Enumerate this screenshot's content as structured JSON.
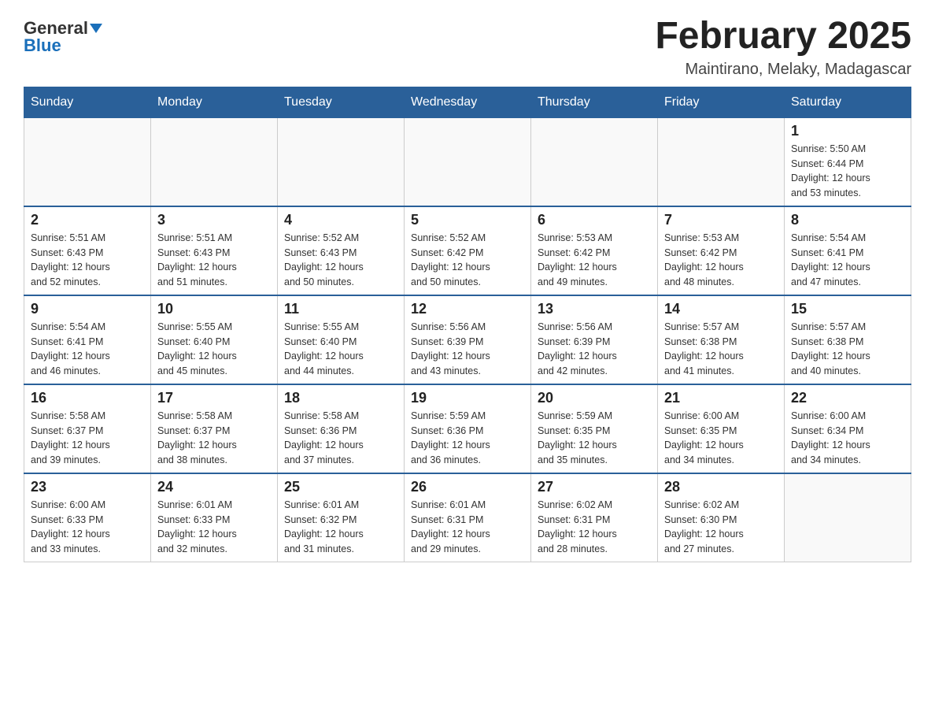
{
  "logo": {
    "general": "General",
    "blue": "Blue"
  },
  "title": "February 2025",
  "location": "Maintirano, Melaky, Madagascar",
  "days_of_week": [
    "Sunday",
    "Monday",
    "Tuesday",
    "Wednesday",
    "Thursday",
    "Friday",
    "Saturday"
  ],
  "weeks": [
    [
      {
        "day": "",
        "info": []
      },
      {
        "day": "",
        "info": []
      },
      {
        "day": "",
        "info": []
      },
      {
        "day": "",
        "info": []
      },
      {
        "day": "",
        "info": []
      },
      {
        "day": "",
        "info": []
      },
      {
        "day": "1",
        "info": [
          "Sunrise: 5:50 AM",
          "Sunset: 6:44 PM",
          "Daylight: 12 hours",
          "and 53 minutes."
        ]
      }
    ],
    [
      {
        "day": "2",
        "info": [
          "Sunrise: 5:51 AM",
          "Sunset: 6:43 PM",
          "Daylight: 12 hours",
          "and 52 minutes."
        ]
      },
      {
        "day": "3",
        "info": [
          "Sunrise: 5:51 AM",
          "Sunset: 6:43 PM",
          "Daylight: 12 hours",
          "and 51 minutes."
        ]
      },
      {
        "day": "4",
        "info": [
          "Sunrise: 5:52 AM",
          "Sunset: 6:43 PM",
          "Daylight: 12 hours",
          "and 50 minutes."
        ]
      },
      {
        "day": "5",
        "info": [
          "Sunrise: 5:52 AM",
          "Sunset: 6:42 PM",
          "Daylight: 12 hours",
          "and 50 minutes."
        ]
      },
      {
        "day": "6",
        "info": [
          "Sunrise: 5:53 AM",
          "Sunset: 6:42 PM",
          "Daylight: 12 hours",
          "and 49 minutes."
        ]
      },
      {
        "day": "7",
        "info": [
          "Sunrise: 5:53 AM",
          "Sunset: 6:42 PM",
          "Daylight: 12 hours",
          "and 48 minutes."
        ]
      },
      {
        "day": "8",
        "info": [
          "Sunrise: 5:54 AM",
          "Sunset: 6:41 PM",
          "Daylight: 12 hours",
          "and 47 minutes."
        ]
      }
    ],
    [
      {
        "day": "9",
        "info": [
          "Sunrise: 5:54 AM",
          "Sunset: 6:41 PM",
          "Daylight: 12 hours",
          "and 46 minutes."
        ]
      },
      {
        "day": "10",
        "info": [
          "Sunrise: 5:55 AM",
          "Sunset: 6:40 PM",
          "Daylight: 12 hours",
          "and 45 minutes."
        ]
      },
      {
        "day": "11",
        "info": [
          "Sunrise: 5:55 AM",
          "Sunset: 6:40 PM",
          "Daylight: 12 hours",
          "and 44 minutes."
        ]
      },
      {
        "day": "12",
        "info": [
          "Sunrise: 5:56 AM",
          "Sunset: 6:39 PM",
          "Daylight: 12 hours",
          "and 43 minutes."
        ]
      },
      {
        "day": "13",
        "info": [
          "Sunrise: 5:56 AM",
          "Sunset: 6:39 PM",
          "Daylight: 12 hours",
          "and 42 minutes."
        ]
      },
      {
        "day": "14",
        "info": [
          "Sunrise: 5:57 AM",
          "Sunset: 6:38 PM",
          "Daylight: 12 hours",
          "and 41 minutes."
        ]
      },
      {
        "day": "15",
        "info": [
          "Sunrise: 5:57 AM",
          "Sunset: 6:38 PM",
          "Daylight: 12 hours",
          "and 40 minutes."
        ]
      }
    ],
    [
      {
        "day": "16",
        "info": [
          "Sunrise: 5:58 AM",
          "Sunset: 6:37 PM",
          "Daylight: 12 hours",
          "and 39 minutes."
        ]
      },
      {
        "day": "17",
        "info": [
          "Sunrise: 5:58 AM",
          "Sunset: 6:37 PM",
          "Daylight: 12 hours",
          "and 38 minutes."
        ]
      },
      {
        "day": "18",
        "info": [
          "Sunrise: 5:58 AM",
          "Sunset: 6:36 PM",
          "Daylight: 12 hours",
          "and 37 minutes."
        ]
      },
      {
        "day": "19",
        "info": [
          "Sunrise: 5:59 AM",
          "Sunset: 6:36 PM",
          "Daylight: 12 hours",
          "and 36 minutes."
        ]
      },
      {
        "day": "20",
        "info": [
          "Sunrise: 5:59 AM",
          "Sunset: 6:35 PM",
          "Daylight: 12 hours",
          "and 35 minutes."
        ]
      },
      {
        "day": "21",
        "info": [
          "Sunrise: 6:00 AM",
          "Sunset: 6:35 PM",
          "Daylight: 12 hours",
          "and 34 minutes."
        ]
      },
      {
        "day": "22",
        "info": [
          "Sunrise: 6:00 AM",
          "Sunset: 6:34 PM",
          "Daylight: 12 hours",
          "and 34 minutes."
        ]
      }
    ],
    [
      {
        "day": "23",
        "info": [
          "Sunrise: 6:00 AM",
          "Sunset: 6:33 PM",
          "Daylight: 12 hours",
          "and 33 minutes."
        ]
      },
      {
        "day": "24",
        "info": [
          "Sunrise: 6:01 AM",
          "Sunset: 6:33 PM",
          "Daylight: 12 hours",
          "and 32 minutes."
        ]
      },
      {
        "day": "25",
        "info": [
          "Sunrise: 6:01 AM",
          "Sunset: 6:32 PM",
          "Daylight: 12 hours",
          "and 31 minutes."
        ]
      },
      {
        "day": "26",
        "info": [
          "Sunrise: 6:01 AM",
          "Sunset: 6:31 PM",
          "Daylight: 12 hours",
          "and 29 minutes."
        ]
      },
      {
        "day": "27",
        "info": [
          "Sunrise: 6:02 AM",
          "Sunset: 6:31 PM",
          "Daylight: 12 hours",
          "and 28 minutes."
        ]
      },
      {
        "day": "28",
        "info": [
          "Sunrise: 6:02 AM",
          "Sunset: 6:30 PM",
          "Daylight: 12 hours",
          "and 27 minutes."
        ]
      },
      {
        "day": "",
        "info": []
      }
    ]
  ]
}
